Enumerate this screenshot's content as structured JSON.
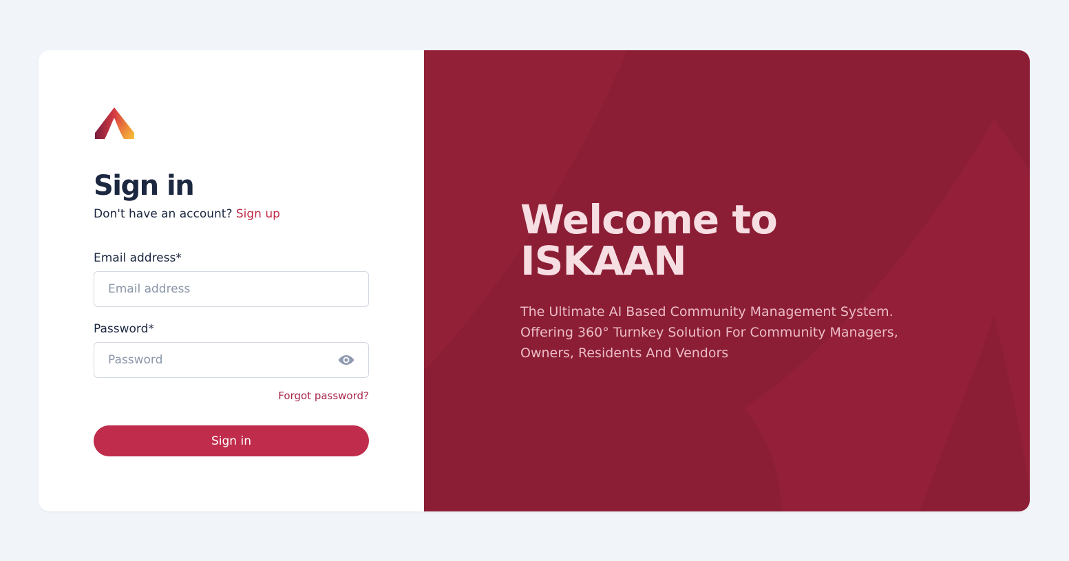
{
  "signin": {
    "title": "Sign in",
    "no_account_text": "Don't have an account? ",
    "signup_link": "Sign up",
    "email_label": "Email address*",
    "email_placeholder": "Email address",
    "password_label": "Password*",
    "password_placeholder": "Password",
    "forgot_password": "Forgot password?",
    "submit_label": "Sign in"
  },
  "hero": {
    "welcome_line1": "Welcome to",
    "welcome_line2": "ISKAAN",
    "tagline": "The Ultimate AI Based Community Management System. Offering 360° Turnkey Solution For Community Managers, Owners, Residents And Vendors"
  },
  "icons": {
    "logo": "tent-logo-icon",
    "password_toggle": "eye-icon"
  },
  "colors": {
    "page_background": "#f1f4f9",
    "brand_primary": "#c02c4b",
    "brand_dark": "#8b1e35",
    "link": "#c02a48",
    "heading": "#1c2740"
  }
}
